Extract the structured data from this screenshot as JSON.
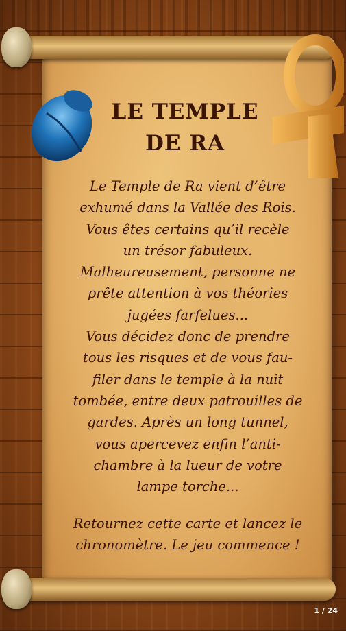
{
  "card": {
    "title": "LE TEMPLE\nDE RA",
    "story": "Le Temple de Ra vient d’être\nexhumé dans la Vallée des Rois.\nVous êtes certains qu’il recèle\nun trésor fabuleux.\nMalheureusement, personne ne\nprête attention à vos théories\njugées farfelues...\nVous décidez donc de prendre\ntous les risques et de vous fau-\nfiler dans le temple à la nuit\ntombée, entre deux patrouilles de\ngardes. Après un long tunnel,\nvous apercevez enfin l’anti-\nchambre à la lueur de votre\nlampe torche...",
    "call_to_action": "Retournez cette carte et lancez le\nchronomètre. Le jeu commence !"
  },
  "decorations": {
    "left_ornament": "scarab-icon",
    "right_ornament": "ankh-icon",
    "scarab_color": "#1f73b8",
    "ankh_color": "#d9912e"
  },
  "pagination": {
    "label": "1 / 24"
  }
}
